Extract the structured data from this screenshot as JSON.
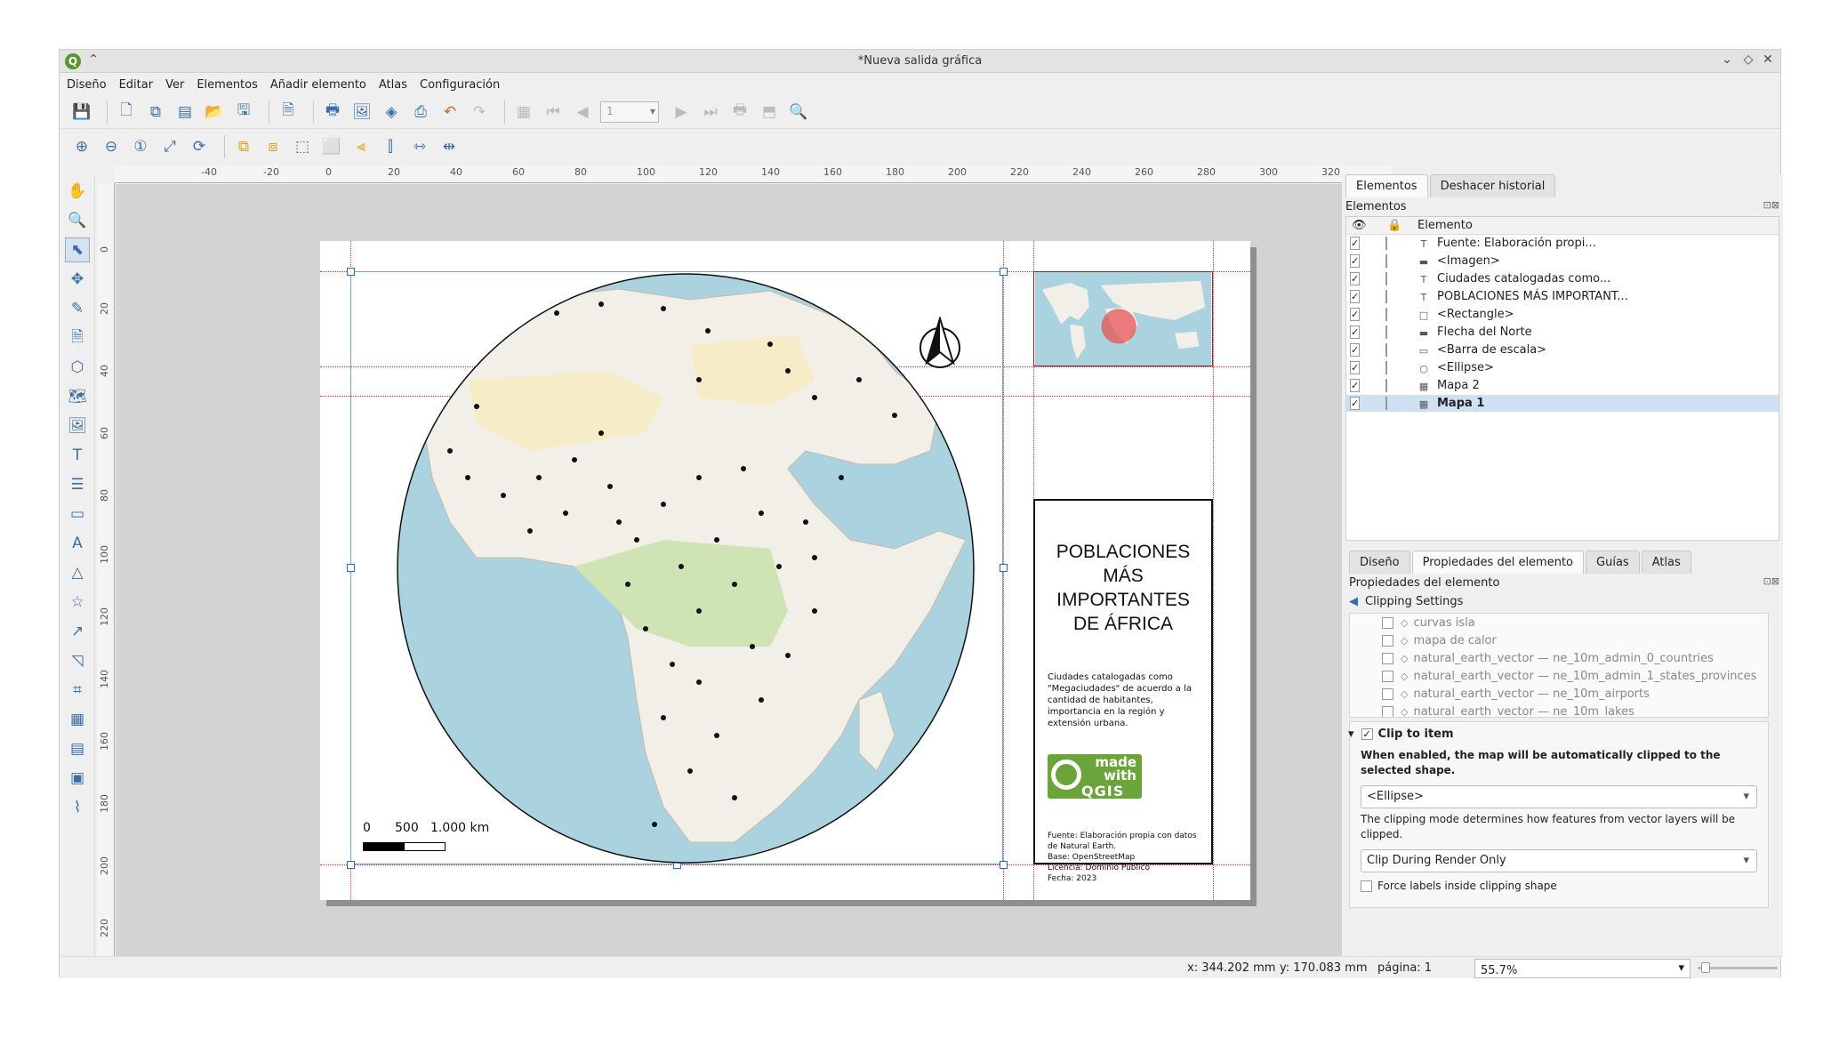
{
  "window": {
    "title": "*Nueva salida gráfica"
  },
  "menu": [
    "Diseño",
    "Editar",
    "Ver",
    "Elementos",
    "Añadir elemento",
    "Atlas",
    "Configuración"
  ],
  "toolbar": {
    "page_value": "1"
  },
  "ruler_h": [
    "-40",
    "-20",
    "0",
    "20",
    "40",
    "60",
    "80",
    "100",
    "120",
    "140",
    "160",
    "180",
    "200",
    "220",
    "240",
    "260",
    "280",
    "300",
    "320"
  ],
  "ruler_v": [
    "0",
    "20",
    "40",
    "60",
    "80",
    "100",
    "120",
    "140",
    "160",
    "180",
    "200",
    "220"
  ],
  "layout": {
    "scalebar": {
      "labels": [
        "0",
        "500",
        "1.000 km"
      ]
    },
    "info": {
      "title": "POBLACIONES MÁS IMPORTANTES DE ÁFRICA",
      "description": "Ciudades catalogadas como \"Megaciudades\" de acuerdo a la cantidad de habitantes, importancia en la región y extensión urbana.",
      "logo_made": "made with",
      "logo_qgis": "QGIS",
      "source": "Fuente: Elaboración propia con datos de Natural Earth.\nBase: OpenStreetMap\nLicencia: Dominio Público\nFecha: 2023"
    }
  },
  "panel": {
    "tabs_top": [
      "Elementos",
      "Deshacer historial"
    ],
    "items_title": "Elementos",
    "col_element": "Elemento",
    "items": [
      {
        "label": "Fuente: Elaboración propi...",
        "icon": "text-icon"
      },
      {
        "label": "<Imagen>",
        "icon": "image-icon"
      },
      {
        "label": "Ciudades catalogadas como...",
        "icon": "text-icon"
      },
      {
        "label": "POBLACIONES MÁS IMPORTANT...",
        "icon": "text-icon"
      },
      {
        "label": "<Rectangle>",
        "icon": "rectangle-icon"
      },
      {
        "label": "Flecha del Norte",
        "icon": "image-icon"
      },
      {
        "label": "<Barra de escala>",
        "icon": "scalebar-icon"
      },
      {
        "label": "<Ellipse>",
        "icon": "ellipse-icon"
      },
      {
        "label": "Mapa 2",
        "icon": "map-icon"
      },
      {
        "label": "Mapa 1",
        "icon": "map-icon"
      }
    ],
    "tabs_bottom": [
      "Diseño",
      "Propiedades del elemento",
      "Guías",
      "Atlas"
    ],
    "props_title": "Propiedades del elemento",
    "back_label": "Clipping Settings",
    "layers": [
      "curvas isla",
      "mapa de calor",
      "natural_earth_vector — ne_10m_admin_0_countries",
      "natural_earth_vector — ne_10m_admin_1_states_provinces",
      "natural_earth_vector — ne_10m_airports",
      "natural_earth_vector — ne_10m_lakes"
    ],
    "clip_label": "Clip to item",
    "clip_help": "When enabled, the map will be automatically clipped to the selected shape.",
    "clip_shape": "<Ellipse>",
    "clip_mode_help": "The clipping mode determines how features from vector layers will be clipped.",
    "clip_mode": "Clip During Render Only",
    "force_labels": "Force labels inside clipping shape"
  },
  "status": {
    "x": "x: 344.202 mm",
    "y": "y: 170.083 mm",
    "page": "página: 1",
    "zoom": "55.7%"
  }
}
